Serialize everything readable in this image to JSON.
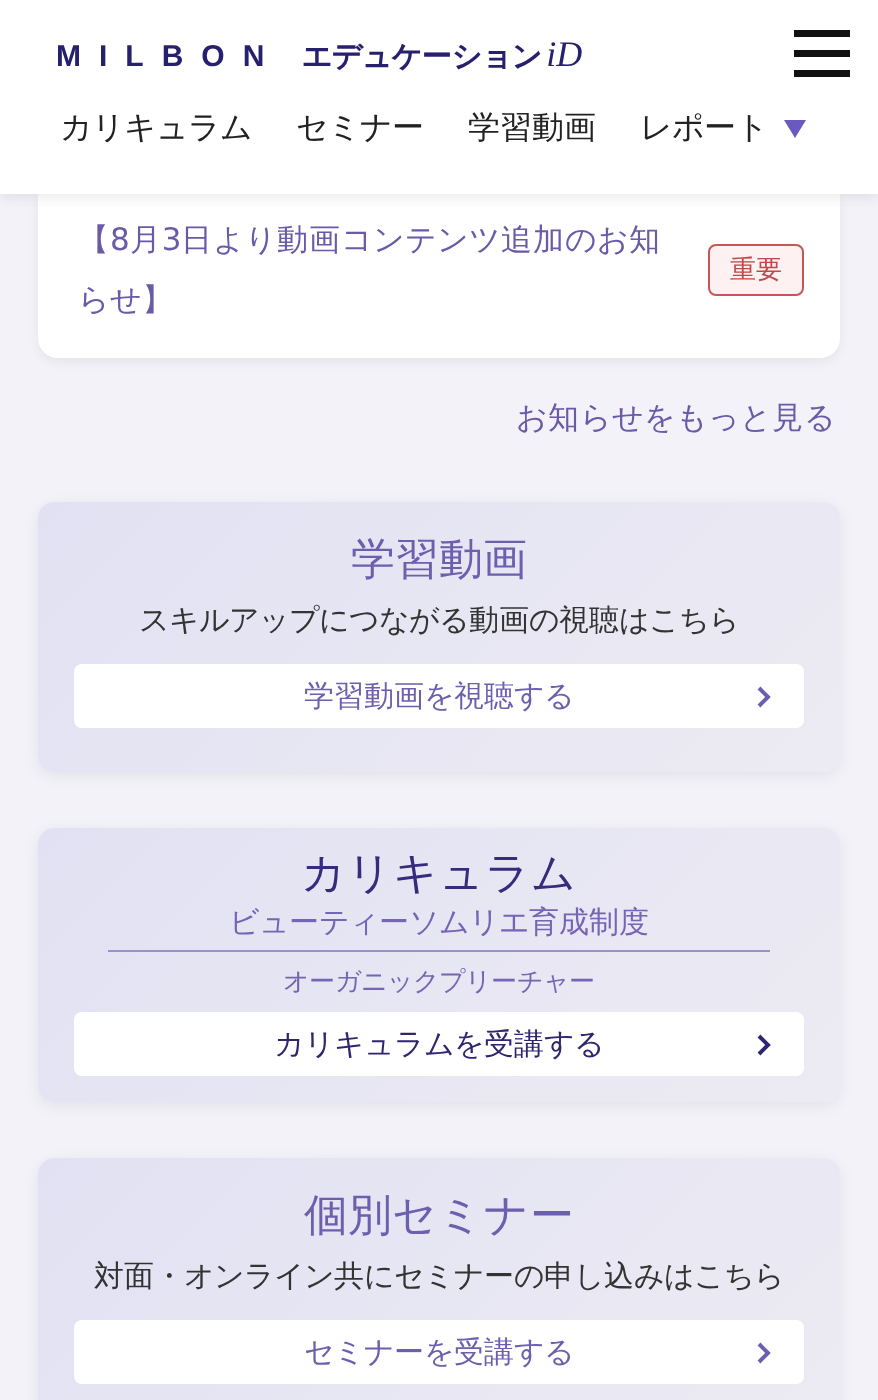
{
  "header": {
    "logo": {
      "brand": "MILBON",
      "product": "エデュケーション",
      "suffix": "iD"
    },
    "nav": [
      {
        "label": "カリキュラム"
      },
      {
        "label": "セミナー"
      },
      {
        "label": "学習動画"
      },
      {
        "label": "レポート"
      }
    ]
  },
  "notice": {
    "text": "【8月3日より動画コンテンツ追加のお知らせ】",
    "tag": "重要"
  },
  "more_link": "お知らせをもっと見る",
  "cards": [
    {
      "title": "学習動画",
      "emphasis": false,
      "lines": [
        {
          "text": "スキルアップにつながる動画の視聴はこちら",
          "kind": "plain"
        }
      ],
      "button": "学習動画を視聴する"
    },
    {
      "title": "カリキュラム",
      "emphasis": true,
      "lines": [
        {
          "text": "ビューティーソムリエ育成制度",
          "kind": "ruled"
        },
        {
          "text": "オーガニックプリーチャー",
          "kind": "small"
        }
      ],
      "button": "カリキュラムを受講する"
    },
    {
      "title": "個別セミナー",
      "emphasis": false,
      "lines": [
        {
          "text": "対面・オンライン共にセミナーの申し込みはこちら",
          "kind": "plain"
        }
      ],
      "button": "セミナーを受講する"
    }
  ]
}
